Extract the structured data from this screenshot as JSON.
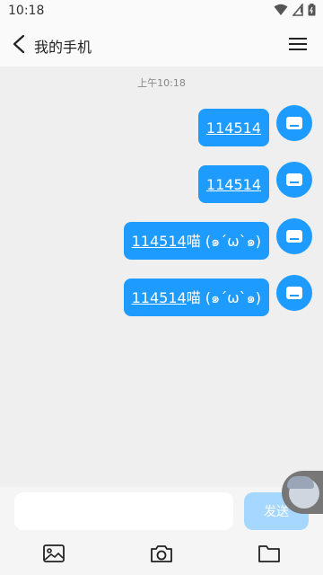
{
  "status_bar": {
    "time": "10:18"
  },
  "header": {
    "title": "我的手机"
  },
  "chat": {
    "timestamp": "上午10:18",
    "messages": [
      {
        "number": "114514",
        "suffix": ""
      },
      {
        "number": "114514",
        "suffix": ""
      },
      {
        "number": "114514",
        "suffix": "喵 (๑´ω`๑)"
      },
      {
        "number": "114514",
        "suffix": "喵 (๑´ω`๑)"
      }
    ]
  },
  "input": {
    "placeholder": "",
    "send_label": "发送"
  },
  "icons": {
    "back": "chevron-left-icon",
    "menu": "hamburger-menu-icon",
    "avatar": "computer-icon",
    "image": "image-icon",
    "camera": "camera-icon",
    "folder": "folder-icon"
  },
  "colors": {
    "accent": "#1e9bff",
    "send_disabled": "#a6d8ff"
  }
}
